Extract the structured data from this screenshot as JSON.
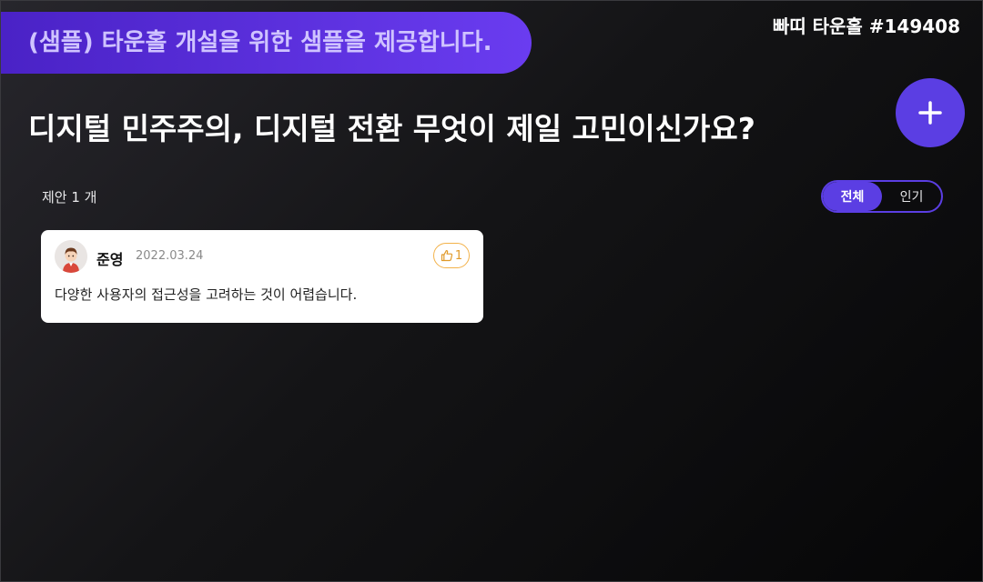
{
  "banner": {
    "text": "(샘플) 타운홀 개설을 위한 샘플을 제공합니다."
  },
  "room": {
    "label": "빠띠 타운홀 #149408"
  },
  "question": {
    "title": "디지털 민주주의, 디지털 전환 무엇이 제일 고민이신가요?"
  },
  "actions": {
    "add_icon": "plus-icon"
  },
  "proposals": {
    "count_label": "제안 1 개",
    "sort_tabs": [
      {
        "label": "전체",
        "active": true
      },
      {
        "label": "인기",
        "active": false
      }
    ],
    "items": [
      {
        "author": "준영",
        "date": "2022.03.24",
        "likes": "1",
        "like_icon": "thumbs-up-icon",
        "text": "다양한 사용자의 접근성을 고려하는 것이 어렵습니다."
      }
    ]
  },
  "colors": {
    "accent": "#5b3ee3",
    "banner_start": "#4a22c6",
    "banner_end": "#6a3cf0",
    "like": "#e09a2a"
  }
}
